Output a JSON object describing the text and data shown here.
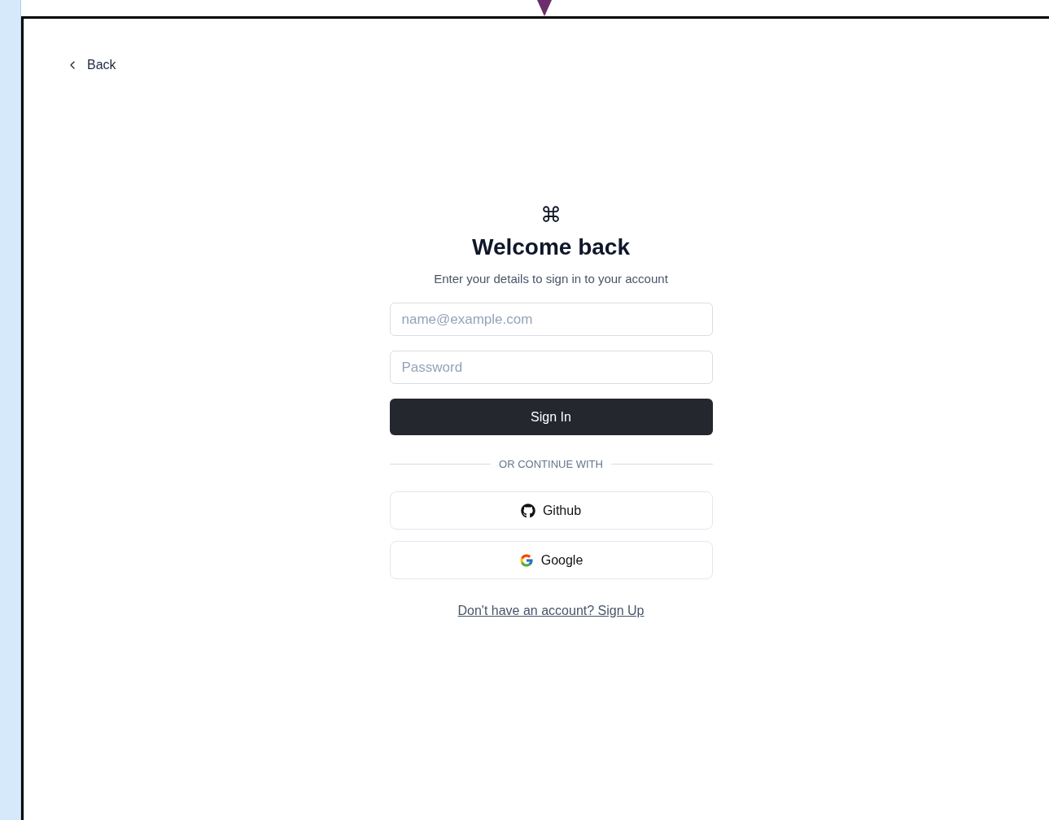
{
  "back_link": {
    "label": "Back"
  },
  "logo": "⌘",
  "title": "Welcome back",
  "subtitle": "Enter your details to sign in to your account",
  "email_field": {
    "placeholder": "name@example.com"
  },
  "password_field": {
    "placeholder": "Password"
  },
  "submit_button": "Sign In",
  "divider": "OR CONTINUE WITH",
  "providers": [
    {
      "kind": "github",
      "label": "Github"
    },
    {
      "kind": "google",
      "label": "Google"
    }
  ],
  "signup_link": "Don't have an account? Sign Up"
}
